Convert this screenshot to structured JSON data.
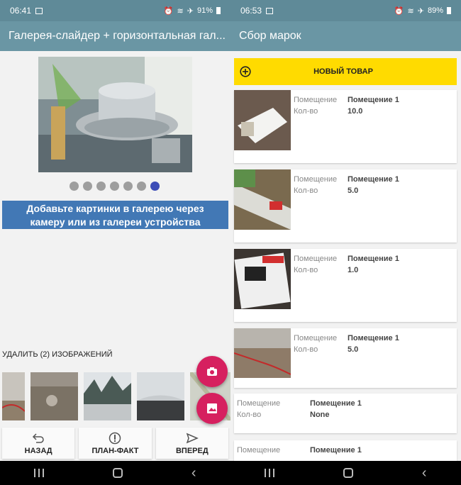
{
  "left": {
    "status": {
      "time": "06:41",
      "battery": "91%"
    },
    "title": "Галерея-слайдер + горизонтальная гал...",
    "dots_count": 7,
    "active_dot": 7,
    "hint_line1": "Добавьте картинки в галерею через",
    "hint_line2": "камеру или из галереи устройства",
    "delete_label": "УДАЛИТЬ (2) ИЗОБРАЖЕНИЙ",
    "buttons": {
      "back": "НАЗАД",
      "plan": "ПЛАН-ФАКТ",
      "forward": "ВПЕРЕД"
    },
    "icons": {
      "camera": "camera-icon",
      "gallery": "image-icon"
    }
  },
  "right": {
    "status": {
      "time": "06:53",
      "battery": "89%"
    },
    "title": "Сбор марок",
    "new_item": "НОВЫЙ ТОВАР",
    "items": [
      {
        "room_label": "Помещение",
        "room": "Помещение 1",
        "qty_label": "Кол-во",
        "qty": "10.0"
      },
      {
        "room_label": "Помещение",
        "room": "Помещение 1",
        "qty_label": "Кол-во",
        "qty": "5.0"
      },
      {
        "room_label": "Помещение",
        "room": "Помещение 1",
        "qty_label": "Кол-во",
        "qty": "1.0"
      },
      {
        "room_label": "Помещение",
        "room": "Помещение 1",
        "qty_label": "Кол-во",
        "qty": "5.0"
      },
      {
        "room_label": "Помещение",
        "room": "Помещение 1",
        "qty_label": "Кол-во",
        "qty": "None"
      },
      {
        "room_label": "Помещение",
        "room": "Помещение 1"
      }
    ]
  },
  "colors": {
    "appbar": "#6a96a4",
    "accent_yellow": "#ffdb00",
    "fab": "#d6205f",
    "hint_bg": "#4278b5",
    "active_dot": "#3d4db7"
  }
}
